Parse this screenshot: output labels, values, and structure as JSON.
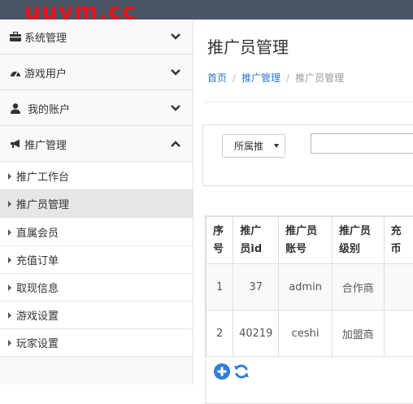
{
  "watermark": "uuym.cc",
  "sidebar": {
    "sections": [
      {
        "label": "系统管理",
        "icon": "briefcase-icon"
      },
      {
        "label": "游戏用户",
        "icon": "dashboard-icon"
      },
      {
        "label": "我的账户",
        "icon": "user-icon"
      },
      {
        "label": "推广管理",
        "icon": "bullhorn-icon"
      }
    ],
    "items": [
      {
        "label": "推广工作台"
      },
      {
        "label": "推广员管理"
      },
      {
        "label": "直属会员"
      },
      {
        "label": "充值订单"
      },
      {
        "label": "取现信息"
      },
      {
        "label": "游戏设置"
      },
      {
        "label": "玩家设置"
      }
    ]
  },
  "main": {
    "title": "推广员管理",
    "breadcrumb": [
      "首页",
      "推广管理",
      "推广员管理"
    ],
    "filter": {
      "select_value": "所属推"
    },
    "table": {
      "headers": [
        [
          "序",
          "号"
        ],
        [
          "推广",
          "员id"
        ],
        [
          "推广员",
          "账号"
        ],
        [
          "推广员",
          "级别"
        ],
        [
          "充",
          "币"
        ]
      ],
      "rows": [
        [
          "1",
          "37",
          "admin",
          "合作商",
          ""
        ],
        [
          "2",
          "40219",
          "ceshi",
          "加盟商",
          ""
        ]
      ]
    }
  },
  "colors": {
    "topbar": "#4a5565",
    "watermark": "#e8141b",
    "link": "#2a77c9",
    "active_item": "#e6e6e6",
    "tool_icon": "#2f7fd6"
  }
}
